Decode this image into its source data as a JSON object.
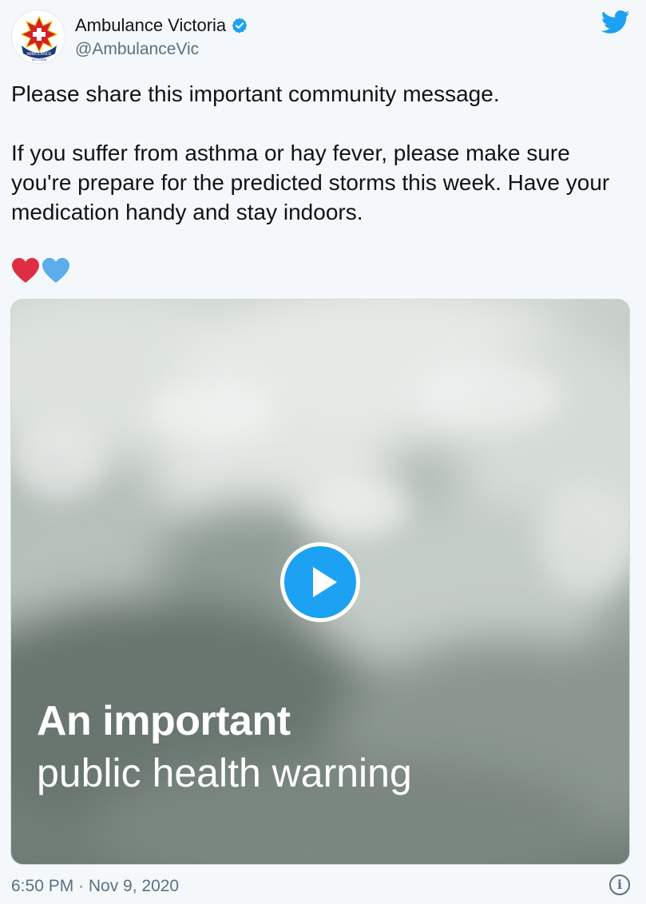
{
  "account": {
    "display_name": "Ambulance Victoria",
    "handle": "@AmbulanceVic",
    "verified": true,
    "avatar_icon": "ambulance-victoria-logo",
    "avatar_text_top": "AMBULANCE",
    "avatar_text_bottom": "VICTORIA"
  },
  "platform_icon": "twitter-bird-icon",
  "tweet": {
    "paragraph_1": "Please share this important community message.",
    "paragraph_2": "If you suffer from asthma or hay fever, please make sure you're prepare for the predicted storms this week. Have your medication handy and stay indoors.",
    "emojis": [
      "red-heart",
      "blue-heart"
    ]
  },
  "media": {
    "type": "video",
    "overlay_title": "An important",
    "overlay_subtitle": "public health warning"
  },
  "footer": {
    "timestamp": "6:50 PM · Nov 9, 2020",
    "info_glyph": "i"
  },
  "colors": {
    "accent": "#1da1f2",
    "heart_red": "#dd2e44",
    "heart_blue": "#5dadec",
    "muted_text": "#5b7083"
  }
}
